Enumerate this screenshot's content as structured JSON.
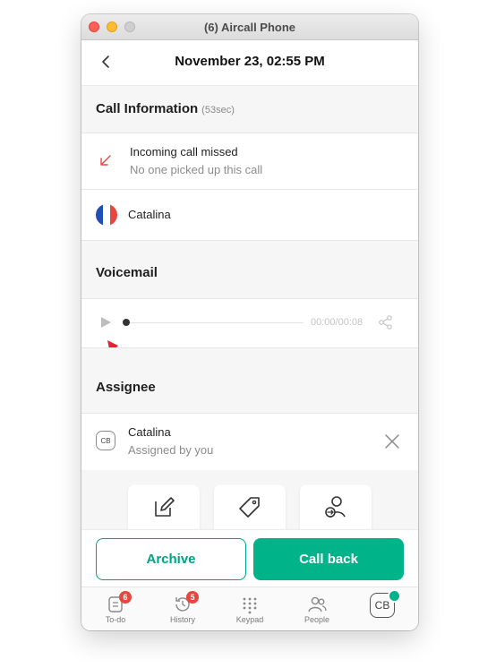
{
  "window": {
    "title": "(6) Aircall Phone"
  },
  "header": {
    "title": "November 23, 02:55 PM"
  },
  "call_info": {
    "title": "Call Information",
    "duration": "(53sec)",
    "status_title": "Incoming call missed",
    "status_sub": "No one picked up this call"
  },
  "contact": {
    "name": "Catalina"
  },
  "voicemail": {
    "title": "Voicemail",
    "time": "00:00/00:08"
  },
  "assignee": {
    "title": "Assignee",
    "name": "Catalina",
    "sub": "Assigned by you",
    "avatar_initials": "CB"
  },
  "buttons": {
    "archive": "Archive",
    "call_back": "Call back"
  },
  "tabs": [
    {
      "label": "To-do",
      "badge": "6"
    },
    {
      "label": "History",
      "badge": "5"
    },
    {
      "label": "Keypad"
    },
    {
      "label": "People"
    }
  ],
  "profile": {
    "initials": "CB"
  },
  "colors": {
    "accent": "#00b388",
    "missed": "#e8473f"
  }
}
